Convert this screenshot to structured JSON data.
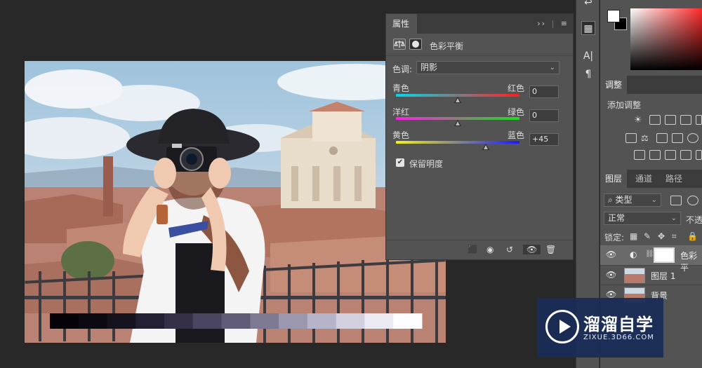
{
  "properties_panel": {
    "tab_label": "属性",
    "menu_glyph": "≡",
    "collapse_glyph": "››",
    "adjustment_title": "色彩平衡",
    "tone_label": "色调:",
    "tone_value": "阴影",
    "sliders": [
      {
        "left": "青色",
        "right": "红色",
        "value": "0",
        "level": 0
      },
      {
        "left": "洋红",
        "right": "绿色",
        "value": "0",
        "level": 0
      },
      {
        "left": "黄色",
        "right": "蓝色",
        "value": "+45",
        "level": 45
      }
    ],
    "preserve_luminosity_label": "保留明度",
    "preserve_luminosity_checked": true
  },
  "right_panel": {
    "adjustments_tab": "调整",
    "add_adjustment_label": "添加调整",
    "layer_tabs": [
      "图层",
      "通道",
      "路径"
    ],
    "filter_kind": "类型",
    "blend_mode": "正常",
    "opacity_label_partial": "不透",
    "lock_label": "锁定:",
    "layers": [
      {
        "name": "色彩平",
        "kind": "adjustment"
      },
      {
        "name": "图层 1",
        "kind": "image"
      },
      {
        "name": "背景",
        "kind": "image"
      }
    ]
  },
  "tool_column": {
    "icons": [
      "history-icon",
      "properties-icon",
      "character-icon",
      "paragraph-icon"
    ]
  },
  "watermark": {
    "brand": "溜溜自学",
    "url": "ZIXUE.3D66.COM"
  },
  "gradient_steps": [
    "#050308",
    "#0c0912",
    "#16131e",
    "#242034",
    "#353047",
    "#4a4560",
    "#615c78",
    "#7d7992",
    "#9a97ae",
    "#b6b4c8",
    "#d2d0df",
    "#ebeaf2",
    "#fdfdff"
  ],
  "colors": {
    "panel_bg": "#535353",
    "canvas_bg": "#282828",
    "watermark_bg": "#192d58"
  }
}
